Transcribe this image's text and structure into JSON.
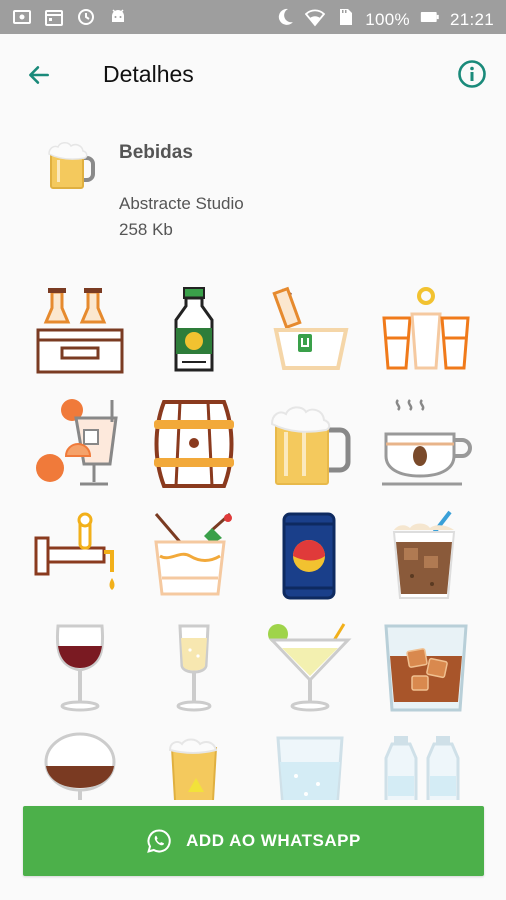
{
  "status_bar": {
    "battery_percent": "100%",
    "time": "21:21",
    "left_icons": [
      "screen-record-icon",
      "calendar-icon",
      "clock-sync-icon",
      "android-icon"
    ],
    "right_icons": [
      "moon-icon",
      "wifi-icon",
      "sd-card-icon",
      "battery-icon"
    ]
  },
  "app_bar": {
    "title": "Detalhes",
    "back_icon": "arrow-left-icon",
    "info_icon": "info-icon",
    "accent_color": "#1a8a7a"
  },
  "pack": {
    "name": "Bebidas",
    "author": "Abstracte Studio",
    "size": "258 Kb",
    "icon": "beer-mug-icon"
  },
  "stickers": [
    {
      "name": "beer-crate-sticker"
    },
    {
      "name": "soda-bottle-sticker"
    },
    {
      "name": "bottle-in-bucket-sticker"
    },
    {
      "name": "shot-glasses-sticker"
    },
    {
      "name": "orange-juice-sticker"
    },
    {
      "name": "wooden-barrel-sticker"
    },
    {
      "name": "beer-mug-sticker"
    },
    {
      "name": "coffee-cup-sticker"
    },
    {
      "name": "beer-tap-sticker"
    },
    {
      "name": "cocktail-glass-sticker"
    },
    {
      "name": "soda-can-sticker"
    },
    {
      "name": "iced-coffee-sticker"
    },
    {
      "name": "red-wine-glass-sticker"
    },
    {
      "name": "champagne-flute-sticker"
    },
    {
      "name": "martini-glass-sticker"
    },
    {
      "name": "whiskey-on-rocks-sticker"
    },
    {
      "name": "brandy-snifter-sticker"
    },
    {
      "name": "small-beer-glass-sticker"
    },
    {
      "name": "water-glass-sticker"
    },
    {
      "name": "water-bottles-sticker"
    }
  ],
  "cta": {
    "label": "ADD AO WHATSAPP",
    "icon": "whatsapp-icon",
    "color": "#4cb04a"
  }
}
